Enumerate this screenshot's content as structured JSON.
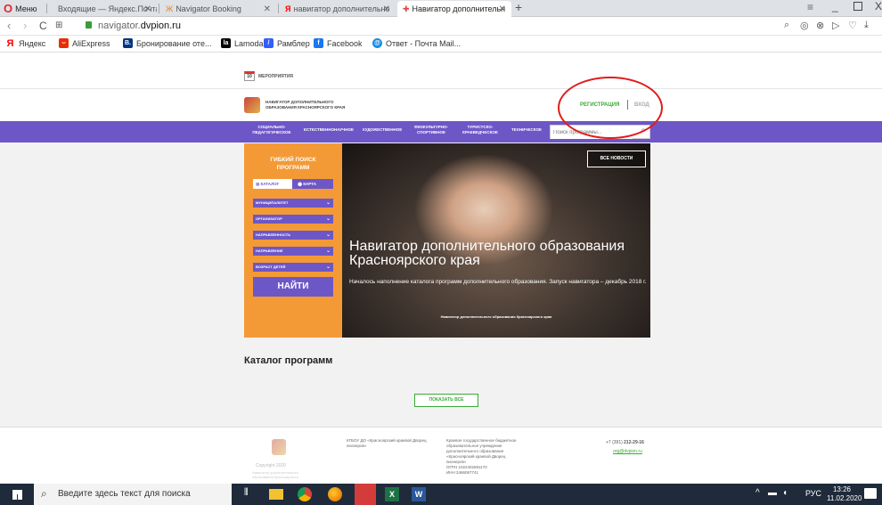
{
  "browser": {
    "menu_label": "Меню",
    "tabs": [
      {
        "title": "Входящие — Яндекс.Почта",
        "active": false
      },
      {
        "title": "Navigator Booking",
        "active": false
      },
      {
        "title": "навигатор дополнительно",
        "active": false
      },
      {
        "title": "Навигатор дополнительн",
        "active": true
      }
    ],
    "new_tab": "+",
    "url_domain": "navigator.",
    "url_host": "dvpion.ru",
    "bookmarks": [
      {
        "label": "Яндекс",
        "color": "#ff0000",
        "glyph": "Я"
      },
      {
        "label": "AliExpress",
        "color": "#e62e04",
        "glyph": ""
      },
      {
        "label": "Бронирование оте...",
        "color": "#003580",
        "glyph": "B."
      },
      {
        "label": "Lamoda",
        "color": "#000000",
        "glyph": "la"
      },
      {
        "label": "Рамблер",
        "color": "#315efb",
        "glyph": "/"
      },
      {
        "label": "Facebook",
        "color": "#1877f2",
        "glyph": "f"
      },
      {
        "label": "Ответ - Почта Mail...",
        "color": "#168de2",
        "glyph": "@"
      }
    ]
  },
  "site": {
    "events_badge": "10",
    "events_label": "МЕРОПРИЯТИЯ",
    "logo_line1": "НАВИГАТОР ДОПОЛНИТЕЛЬНОГО",
    "logo_line2": "ОБРАЗОВАНИЯ КРАСНОЯРСКОГО КРАЯ",
    "register": "РЕГИСТРАЦИЯ",
    "login": "ВХОД",
    "nav": [
      {
        "l1": "СОЦИАЛЬНО-",
        "l2": "ПЕДАГОГИЧЕСКОЕ"
      },
      {
        "l1": "ЕСТЕСТВЕННОНАУЧНОЕ",
        "l2": ""
      },
      {
        "l1": "ХУДОЖЕСТВЕННОЕ",
        "l2": ""
      },
      {
        "l1": "ФИЗКУЛЬТУРНО-",
        "l2": "СПОРТИВНОЕ"
      },
      {
        "l1": "ТУРИСТСКО-",
        "l2": "КРАЕВЕДЧЕСКОЕ"
      },
      {
        "l1": "ТЕХНИЧЕСКОЕ",
        "l2": ""
      }
    ],
    "search_placeholder": "Поиск программы...",
    "filter_title_1": "ГИБКИЙ ПОИСК",
    "filter_title_2": "ПРОГРАММ",
    "filter_tab_catalog": "КАТАЛОГ",
    "filter_tab_map": "КАРТА",
    "filter_dropdowns": [
      "МУНИЦИПАЛИТЕТ",
      "ОРГАНИЗАТОР",
      "НАПРАВЛЕННОСТЬ",
      "НАПРАВЛЕНИЕ",
      "ВОЗРАСТ ДЕТЕЙ"
    ],
    "find_button": "НАЙТИ",
    "all_news": "ВСЕ НОВОСТИ",
    "hero_title_1": "Навигатор дополнительного образования",
    "hero_title_2": "Красноярского края",
    "hero_text": "Началось наполнение каталога программ дополнительного образования. Запуск навигатора – декабрь 2018 г.",
    "hero_caption": "Навигатор дополнительного образования Красноярского края",
    "catalog_title": "Каталог программ",
    "show_all": "ПОКАЗАТЬ ВСЕ",
    "footer": {
      "copyright": "Copyright 2020",
      "copyright_sub": "Навигатор дополнительного образования Красноярского",
      "org": "КГБОУ ДО «Красноярский краевой Дворец пионеров»",
      "org_full": "Краевое государственное бюджетное образовательное учреждение дополнительного образования «Красноярский краевой Дворец пионеров»",
      "ogrn": "ОГРН 1022402681170",
      "inn": "ИНН 2466067741",
      "phone_prefix": "+7 (391) ",
      "phone": "212-29-16",
      "email": "org@dvpion.ru"
    }
  },
  "taskbar": {
    "search_placeholder": "Введите здесь текст для поиска",
    "lang": "РУС",
    "time": "13:26",
    "date": "11.02.2020"
  },
  "colors": {
    "purple": "#6d57c7",
    "orange": "#f39a36",
    "green": "#3aaa35",
    "annotation_red": "#e31b1b"
  }
}
